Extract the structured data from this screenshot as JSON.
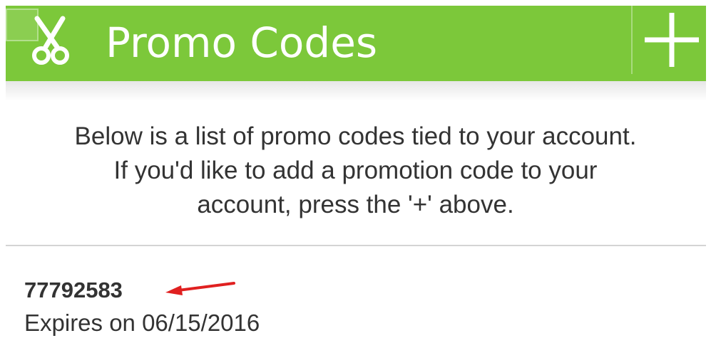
{
  "action_bar": {
    "title": "Promo Codes",
    "app_icon": "scissors-icon",
    "add_icon": "plus-icon",
    "color": "#7cc83a"
  },
  "info": {
    "lines": [
      "Below is a list of promo codes tied to your account.",
      "If you'd like to add a promotion code to your",
      "account, press the '+' above."
    ]
  },
  "promo": {
    "code": "77792583",
    "expires": "Expires on 06/15/2016",
    "annotation_icon": "red-arrow-icon",
    "annotation_color": "#e02020"
  }
}
